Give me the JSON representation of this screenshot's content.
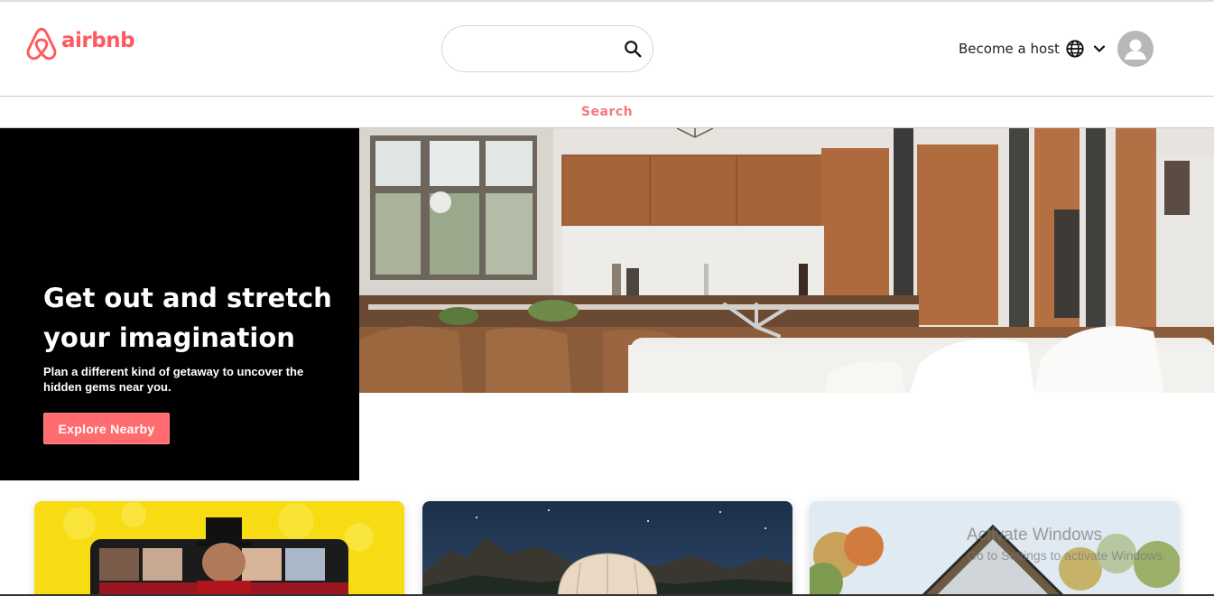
{
  "header": {
    "logo_text": "airbnb",
    "search": {
      "value": "",
      "placeholder": ""
    },
    "host_link": "Become a host",
    "brand_color": "#ff5a5f"
  },
  "search_bar": {
    "label": "Search"
  },
  "hero": {
    "title": "Get out and stretch your imagination",
    "subtitle": "Plan a different kind of getaway to uncover the hidden gems near you.",
    "button_label": "Explore Nearby",
    "button_color": "#ff6b6f"
  },
  "cards": [
    {
      "image": "online-experience-photo"
    },
    {
      "image": "dome-night-photo"
    },
    {
      "image": "a-frame-cabin-photo"
    }
  ],
  "icons": {
    "logo": "airbnb-logo-icon",
    "search": "search-icon",
    "globe": "globe-icon",
    "chevron": "chevron-down-icon",
    "avatar": "user-avatar-icon"
  },
  "watermark": {
    "line1": "Activate Windows",
    "line2": "Go to Settings to activate Windows."
  }
}
